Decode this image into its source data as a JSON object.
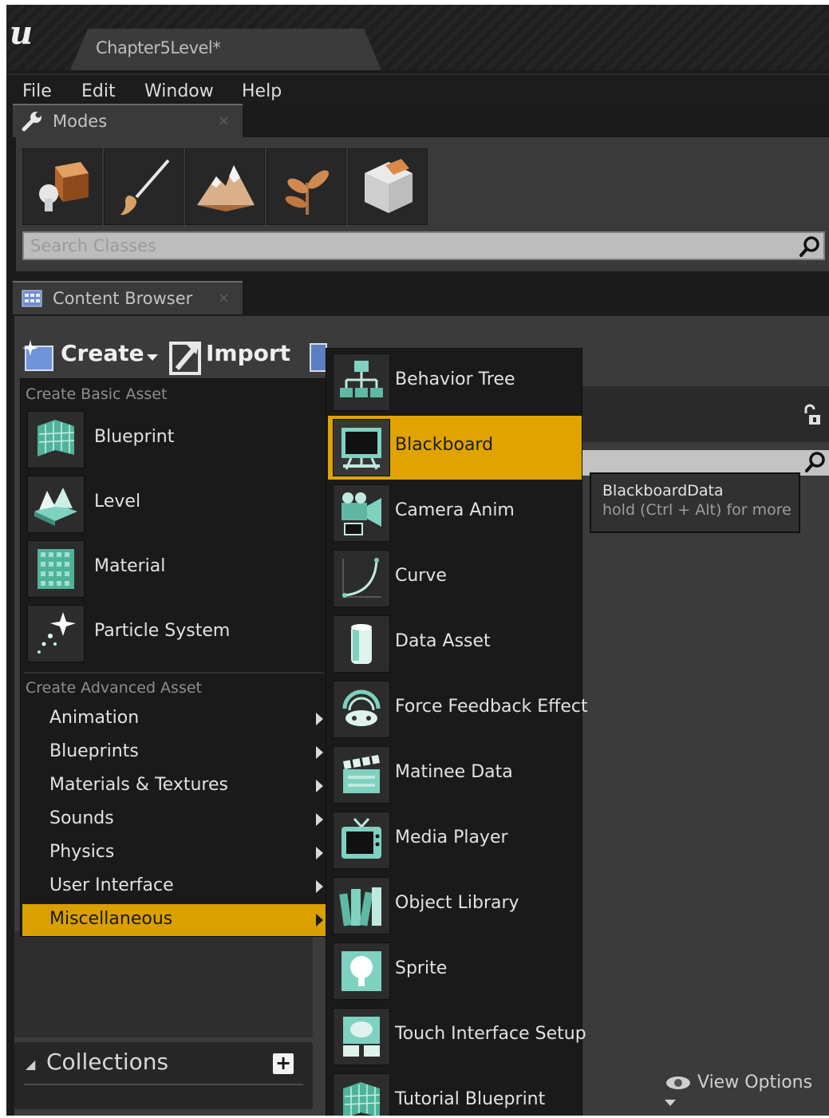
{
  "app": {
    "document_tab": "Chapter5Level*",
    "logo": "u"
  },
  "menubar": [
    "File",
    "Edit",
    "Window",
    "Help"
  ],
  "modes_panel": {
    "tab_label": "Modes",
    "close": "×",
    "mode_icons": [
      "place-mode-icon",
      "paint-mode-icon",
      "landscape-mode-icon",
      "foliage-mode-icon",
      "geometry-mode-icon"
    ],
    "search_placeholder": "Search Classes"
  },
  "content_browser": {
    "tab_label": "Content Browser",
    "close": "×",
    "create_label": "Create",
    "import_label": "Import",
    "collections_label": "Collections",
    "collections_add": "+",
    "view_options_label": "View Options"
  },
  "create_menu": {
    "basic_header": "Create Basic Asset",
    "basic_items": [
      {
        "label": "Blueprint",
        "icon": "blueprint-icon"
      },
      {
        "label": "Level",
        "icon": "level-icon"
      },
      {
        "label": "Material",
        "icon": "material-icon"
      },
      {
        "label": "Particle System",
        "icon": "particle-system-icon"
      }
    ],
    "advanced_header": "Create Advanced Asset",
    "advanced_items": [
      {
        "label": "Animation"
      },
      {
        "label": "Blueprints"
      },
      {
        "label": "Materials & Textures"
      },
      {
        "label": "Sounds"
      },
      {
        "label": "Physics"
      },
      {
        "label": "User Interface"
      },
      {
        "label": "Miscellaneous",
        "selected": true
      }
    ]
  },
  "misc_submenu": [
    {
      "label": "Behavior Tree",
      "icon": "behavior-tree-icon"
    },
    {
      "label": "Blackboard",
      "icon": "blackboard-icon",
      "selected": true
    },
    {
      "label": "Camera Anim",
      "icon": "camera-anim-icon"
    },
    {
      "label": "Curve",
      "icon": "curve-icon"
    },
    {
      "label": "Data Asset",
      "icon": "data-asset-icon"
    },
    {
      "label": "Force Feedback Effect",
      "icon": "force-feedback-icon"
    },
    {
      "label": "Matinee Data",
      "icon": "matinee-data-icon"
    },
    {
      "label": "Media Player",
      "icon": "media-player-icon"
    },
    {
      "label": "Object Library",
      "icon": "object-library-icon"
    },
    {
      "label": "Sprite",
      "icon": "sprite-icon"
    },
    {
      "label": "Touch Interface Setup",
      "icon": "touch-interface-icon"
    },
    {
      "label": "Tutorial Blueprint",
      "icon": "tutorial-blueprint-icon"
    }
  ],
  "tooltip": {
    "title": "BlackboardData",
    "hint": "hold (Ctrl + Alt) for more"
  },
  "colors": {
    "highlight": "#e0a300",
    "menu_bg": "#1a1a1a",
    "panel_bg": "#3b3b3b",
    "icon_teal": "#7fd1c0"
  }
}
